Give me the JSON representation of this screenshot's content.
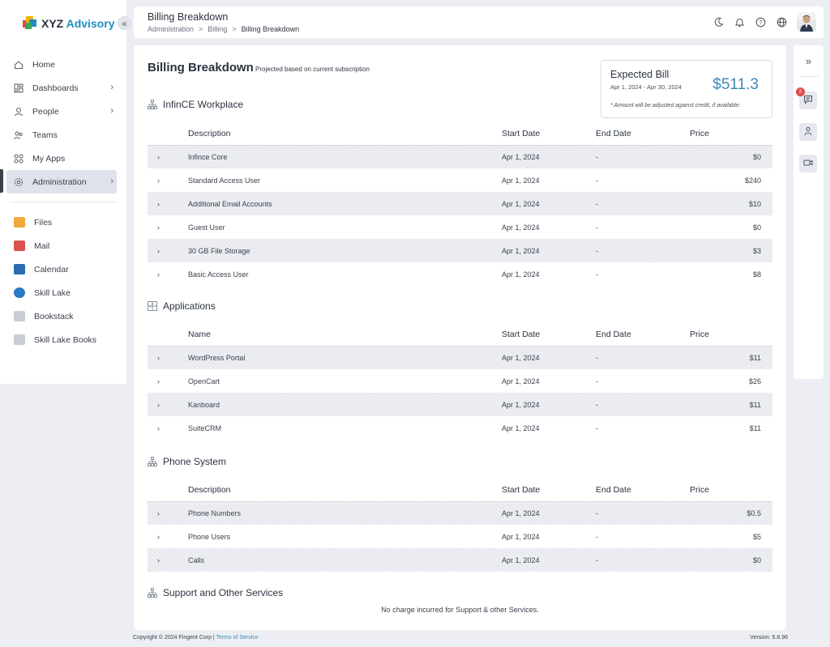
{
  "app": {
    "logo_text": "XYZ",
    "logo_accent": "Advisory",
    "brand_colors": [
      "#e8453c",
      "#f4b400",
      "#1f8fbf",
      "#3aa757"
    ]
  },
  "sidebar": {
    "collapse_label": "«",
    "items": [
      {
        "label": "Home",
        "icon": "home-icon"
      },
      {
        "label": "Dashboards",
        "icon": "dashboard-icon",
        "chevron": "›"
      },
      {
        "label": "People",
        "icon": "people-icon",
        "chevron": "›"
      },
      {
        "label": "Teams",
        "icon": "teams-icon"
      },
      {
        "label": "My Apps",
        "icon": "apps-icon"
      },
      {
        "label": "Administration",
        "icon": "gear-icon",
        "chevron": "›",
        "active": true
      }
    ],
    "apps": [
      {
        "label": "Files",
        "icon": "files-icon",
        "color": "#f2a93b"
      },
      {
        "label": "Mail",
        "icon": "mail-icon",
        "color": "#d9534f"
      },
      {
        "label": "Calendar",
        "icon": "calendar-icon",
        "color": "#2b6cb0"
      },
      {
        "label": "Skill Lake",
        "icon": "skill-lake-icon",
        "color": "#2b78c4"
      },
      {
        "label": "Bookstack",
        "icon": "bookstack-icon",
        "color": "#c9ccd3"
      },
      {
        "label": "Skill Lake Books",
        "icon": "skill-lake-books-icon",
        "color": "#c9ccd3"
      }
    ]
  },
  "header": {
    "title": "Billing Breakdown",
    "breadcrumb": [
      "Administration",
      "Billing",
      "Billing Breakdown"
    ],
    "breadcrumb_sep": ">"
  },
  "page": {
    "title": "Billing Breakdown",
    "subtitle": "Projected based on current subscription"
  },
  "bill": {
    "title": "Expected Bill",
    "range": "Apr 1, 2024 - Apr 30, 2024",
    "amount": "$511.3",
    "note": "* Amount will be adjusted against credit, if available."
  },
  "columns": {
    "description": "Description",
    "name": "Name",
    "start": "Start Date",
    "end": "End Date",
    "price": "Price"
  },
  "sections": {
    "workplace": {
      "title": "InfinCE Workplace",
      "rows": [
        {
          "desc": "Infince Core",
          "start": "Apr 1, 2024",
          "end": "-",
          "price": "$0"
        },
        {
          "desc": "Standard Access User",
          "start": "Apr 1, 2024",
          "end": "-",
          "price": "$240"
        },
        {
          "desc": "Additional Email Accounts",
          "start": "Apr 1, 2024",
          "end": "-",
          "price": "$10"
        },
        {
          "desc": "Guest User",
          "start": "Apr 1, 2024",
          "end": "-",
          "price": "$0"
        },
        {
          "desc": "30 GB File Storage",
          "start": "Apr 1, 2024",
          "end": "-",
          "price": "$3"
        },
        {
          "desc": "Basic Access User",
          "start": "Apr 1, 2024",
          "end": "-",
          "price": "$8"
        }
      ]
    },
    "applications": {
      "title": "Applications",
      "rows": [
        {
          "desc": "WordPress Portal",
          "start": "Apr 1, 2024",
          "end": "-",
          "price": "$11"
        },
        {
          "desc": "OpenCart",
          "start": "Apr 1, 2024",
          "end": "-",
          "price": "$26"
        },
        {
          "desc": "Kanboard",
          "start": "Apr 1, 2024",
          "end": "-",
          "price": "$11"
        },
        {
          "desc": "SuiteCRM",
          "start": "Apr 1, 2024",
          "end": "-",
          "price": "$11"
        }
      ]
    },
    "phone": {
      "title": "Phone System",
      "rows": [
        {
          "desc": "Phone Numbers",
          "start": "Apr 1, 2024",
          "end": "-",
          "price": "$0.5"
        },
        {
          "desc": "Phone Users",
          "start": "Apr 1, 2024",
          "end": "-",
          "price": "$5"
        },
        {
          "desc": "Calls",
          "start": "Apr 1, 2024",
          "end": "-",
          "price": "$0"
        }
      ]
    },
    "support": {
      "title": "Support and Other Services",
      "message": "No charge incurred for Support & other Services."
    }
  },
  "rail": {
    "expand_label": "»",
    "chat_badge": "2"
  },
  "footer": {
    "copyright": "Copyright © 2024 Fingent Corp | ",
    "terms": "Terms of Service",
    "version": "Version: 5.8.96"
  }
}
